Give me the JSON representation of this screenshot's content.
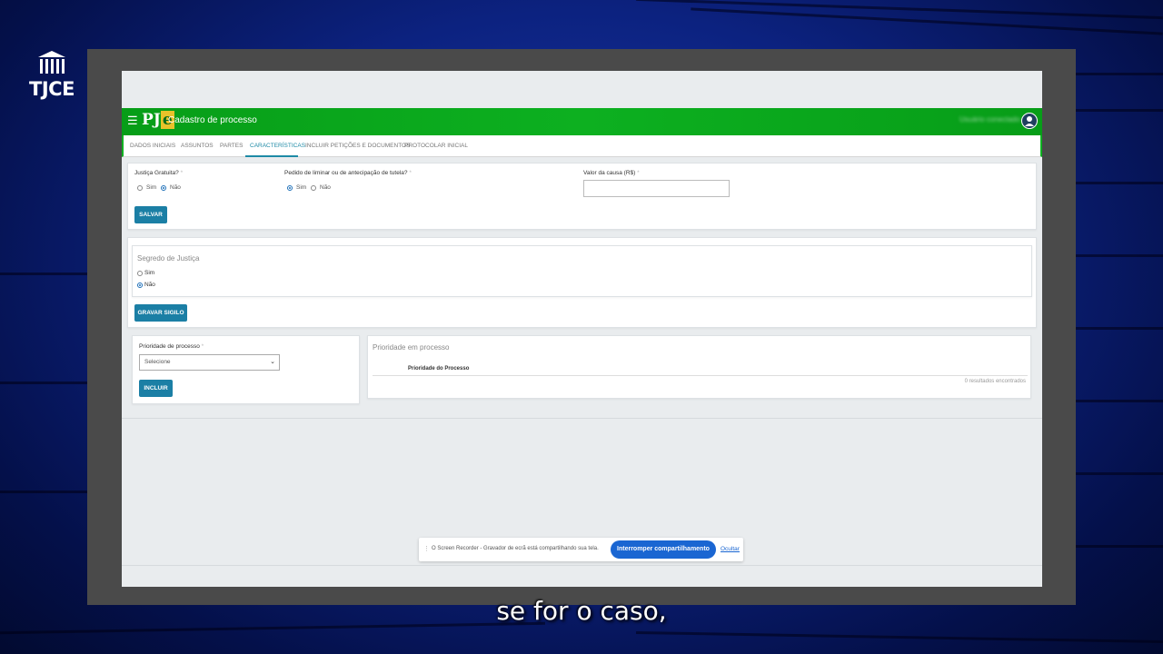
{
  "channel": {
    "logo_text": "TJCE"
  },
  "app": {
    "logo": "PJe",
    "title": "Cadastro de processo",
    "user_name": "Usuário conectado",
    "menu_icon": "menu-icon",
    "avatar_icon": "user-avatar-icon",
    "accent_color": "#0db020"
  },
  "tabs": [
    {
      "label": "DADOS INICIAIS"
    },
    {
      "label": "ASSUNTOS"
    },
    {
      "label": "PARTES"
    },
    {
      "label": "CARACTERÍSTICAS",
      "active": true
    },
    {
      "label": "INCLUIR PETIÇÕES E DOCUMENTOS"
    },
    {
      "label": "PROTOCOLAR INICIAL"
    }
  ],
  "characteristics": {
    "justica_gratuita": {
      "label": "Justiça Gratuita?",
      "options": [
        "Sim",
        "Não"
      ],
      "selected": "Não"
    },
    "pedido_liminar": {
      "label": "Pedido de liminar ou de antecipação de tutela?",
      "options": [
        "Sim",
        "Não"
      ],
      "selected": "Sim"
    },
    "valor_causa": {
      "label": "Valor da causa (R$)",
      "value": ""
    },
    "required_mark": "*",
    "save_label": "SALVAR"
  },
  "segredo": {
    "title": "Segredo de Justiça",
    "options": [
      "Sim",
      "Não"
    ],
    "selected": "Não",
    "save_label": "GRAVAR SIGILO"
  },
  "prioridade": {
    "label": "Prioridade de processo",
    "select_value": "Selecione",
    "add_label": "INCLUIR",
    "panel_title": "Prioridade em processo",
    "column_header": "Prioridade do Processo",
    "results": "0 resultados encontrados"
  },
  "share_bar": {
    "message": "O Screen Recorder - Gravador de ecrã está compartilhando sua tela.",
    "stop_label": "Interromper compartilhamento",
    "hide_label": "Ocultar"
  },
  "subtitle": "se for o caso,"
}
